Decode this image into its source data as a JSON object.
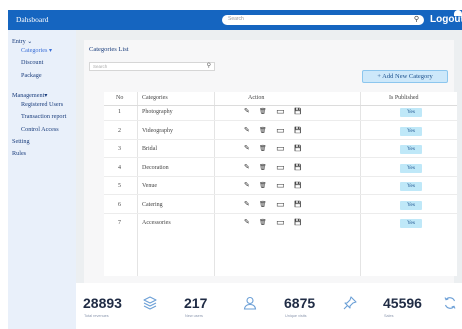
{
  "header": {
    "brand": "Dahsboard",
    "search_placeholder": "Search",
    "logout_label": "Logout"
  },
  "sidebar": {
    "entry": "Entry",
    "entry_items": [
      "Categories",
      "Discount",
      "Package"
    ],
    "management": "Management",
    "management_items": [
      "Registered Users",
      "Transaction report",
      "Control Access"
    ],
    "setting": "Setting",
    "rules": "Rules"
  },
  "main": {
    "title": "Categories List",
    "search_placeholder": "Search",
    "add_button": "+ Add New Category"
  },
  "table": {
    "headers": [
      "No",
      "Categories",
      "Action",
      "Is Published"
    ],
    "rows": [
      {
        "no": "1",
        "name": "Photography",
        "published": "Yes"
      },
      {
        "no": "2",
        "name": "Videography",
        "published": "Yes"
      },
      {
        "no": "3",
        "name": "Bridal",
        "published": "Yes"
      },
      {
        "no": "4",
        "name": "Decoration",
        "published": "Yes"
      },
      {
        "no": "5",
        "name": "Venue",
        "published": "Yes"
      },
      {
        "no": "6",
        "name": "Catering",
        "published": "Yes"
      },
      {
        "no": "7",
        "name": "Accessories",
        "published": "Yes"
      }
    ]
  },
  "stats": [
    {
      "value": "28893",
      "label": "Total revenues",
      "icon": "layers-icon"
    },
    {
      "value": "217",
      "label": "New users",
      "icon": "users-icon"
    },
    {
      "value": "6875",
      "label": "Unique visits",
      "icon": "pin-icon"
    },
    {
      "value": "45596",
      "label": "Sales",
      "icon": "refresh-icon"
    }
  ],
  "colors": {
    "primary": "#1565c0",
    "sidebar_bg": "#e9f0fa",
    "badge": "#bfe8f8",
    "stat_icon": "#6b9fd6"
  }
}
